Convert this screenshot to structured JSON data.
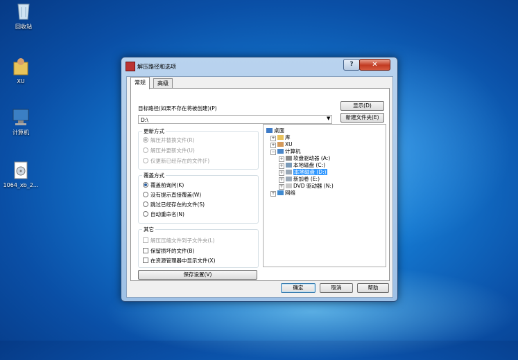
{
  "desktop": {
    "icons": [
      {
        "label": "回收站"
      },
      {
        "label": "XU"
      },
      {
        "label": "计算机"
      },
      {
        "label": "1064_xb_2..."
      }
    ]
  },
  "dialog": {
    "title": "解压路径和选项",
    "help_symbol": "?",
    "close_symbol": "✕",
    "tabs": [
      "常规",
      "高级"
    ],
    "target_label": "目标路径(如果不存在将被创建)(P)",
    "path_value": "D:\\",
    "dropdown_arrow": "▼",
    "buttons": {
      "show": "显示(D)",
      "new_folder": "新建文件夹(E)",
      "save_settings": "保存设置(V)",
      "ok": "确定",
      "cancel": "取消",
      "help": "帮助"
    },
    "update_mode": {
      "title": "更新方式",
      "options": [
        "解压并替换文件(R)",
        "解压并更新文件(U)",
        "仅更新已经存在的文件(F)"
      ],
      "selected_index": 0
    },
    "overwrite_mode": {
      "title": "覆盖方式",
      "options": [
        "覆盖前询问(K)",
        "没有提示直接覆盖(W)",
        "跳过已经存在的文件(S)",
        "自动重命名(N)"
      ],
      "selected_index": 0
    },
    "misc": {
      "title": "其它",
      "options": [
        "解压压缩文件到子文件夹(L)",
        "保留损坏的文件(B)",
        "在资源管理器中显示文件(X)"
      ]
    },
    "tree": [
      {
        "label": "桌面"
      },
      {
        "label": "库"
      },
      {
        "label": "XU"
      },
      {
        "label": "计算机"
      },
      {
        "label": "软盘驱动器 (A:)"
      },
      {
        "label": "本地磁盘 (C:)"
      },
      {
        "label": "本地磁盘 (D:)"
      },
      {
        "label": "新加卷 (E:)"
      },
      {
        "label": "DVD 驱动器 (N:)"
      },
      {
        "label": "网络"
      }
    ]
  }
}
